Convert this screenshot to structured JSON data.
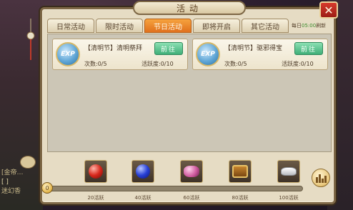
{
  "window": {
    "title": "活动",
    "close_glyph": "✕"
  },
  "tabs": [
    {
      "label": "日常活动",
      "active": false
    },
    {
      "label": "限时活动",
      "active": false
    },
    {
      "label": "节日活动",
      "active": true
    },
    {
      "label": "即将开启",
      "active": false
    },
    {
      "label": "其它活动",
      "active": false
    }
  ],
  "refresh": {
    "prefix": "每日",
    "time": "05:00",
    "suffix": "刷新"
  },
  "activities": [
    {
      "icon": "exp-icon",
      "icon_text": "EXP",
      "title": "【清明节】清明祭拜",
      "button": "前往",
      "count": "次数:0/5",
      "activity": "活跃度:0/10"
    },
    {
      "icon": "exp-icon",
      "icon_text": "EXP",
      "title": "【清明节】驱邪得宝",
      "button": "前往",
      "count": "次数:0/5",
      "activity": "活跃度:0/10"
    }
  ],
  "progress": {
    "current": "0",
    "fraction": 0
  },
  "rewards": [
    {
      "icon": "red-gem-icon",
      "label": "20活跃"
    },
    {
      "icon": "blue-gem-icon",
      "label": "40活跃"
    },
    {
      "icon": "pink-gem-icon",
      "label": "60活跃"
    },
    {
      "icon": "treasure-chest-icon",
      "label": "80活跃"
    },
    {
      "icon": "silver-ingot-icon",
      "label": "100活跃"
    }
  ],
  "background_chat": {
    "line1": "[金帝…",
    "line2": "[ ]",
    "line3": "迷幻香"
  }
}
